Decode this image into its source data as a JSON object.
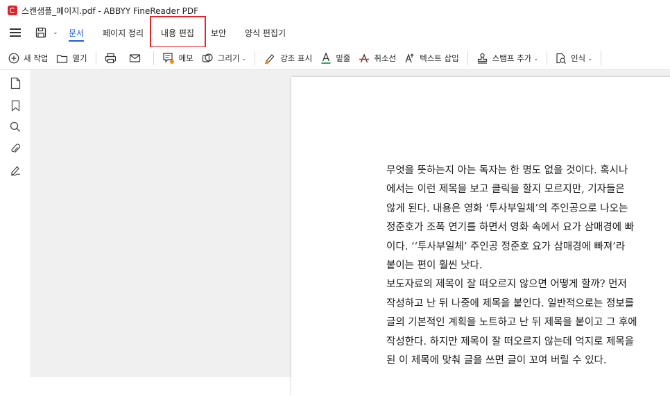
{
  "window": {
    "title": "스캔샘플_페이지.pdf - ABBYY FineReader PDF"
  },
  "menu": {
    "tabs": [
      {
        "label": "문서",
        "active": true
      },
      {
        "label": "페이지 정리",
        "active": false
      },
      {
        "label": "내용 편집",
        "active": false
      },
      {
        "label": "보안",
        "active": false
      },
      {
        "label": "양식 편집기",
        "active": false
      }
    ],
    "caret": "⌄"
  },
  "toolbar": {
    "new_task": "새 작업",
    "open": "열기",
    "memo": "메모",
    "draw": "그리기",
    "highlight": "강조 표시",
    "underline": "밑줄",
    "strikethrough": "취소선",
    "insert_text": "텍스트 삽입",
    "stamp": "스탬프 추가",
    "recognize": "인식",
    "caret": "⌄"
  },
  "colors": {
    "accent": "#1a5fd4",
    "highlight_box": "#e0252b",
    "memo_dot": "#f28c1e",
    "underline_green": "#2fa84f",
    "strike_red": "#e0252b",
    "logo_red": "#d8262d"
  },
  "document": {
    "lines": [
      "무엇을 뜻하는지 아는 독자는 한 명도 없을 것이다. 혹시나",
      "에서는 이런 제목을 보고 클릭을 할지 모르지만, 기자들은",
      "않게 된다. 내용은 영화 ‘투사부일체’의 주인공으로 나오는",
      "정준호가 조폭 연기를 하면서 영화 속에서 요가 삼매경에 빠",
      "이다. ‘‘투사부일체’ 주인공 정준호 요가 삼매경에 빠져’라",
      "붙이는 편이 훨씬 낫다.",
      "  보도자료의 제목이 잘 떠오르지 않으면 어떻게 할까? 먼저",
      "작성하고 난 뒤 나중에 제목을 붙인다. 일반적으로는 정보를",
      "글의 기본적인 계획을 노트하고 난 뒤 제목을 붙이고 그 후에",
      "작성한다. 하지만 제목이 잘 떠오르지 않는데 억지로 제목을",
      "된 이 제목에 맞춰 글을 쓰면 글이 꼬여 버릴 수 있다."
    ]
  }
}
